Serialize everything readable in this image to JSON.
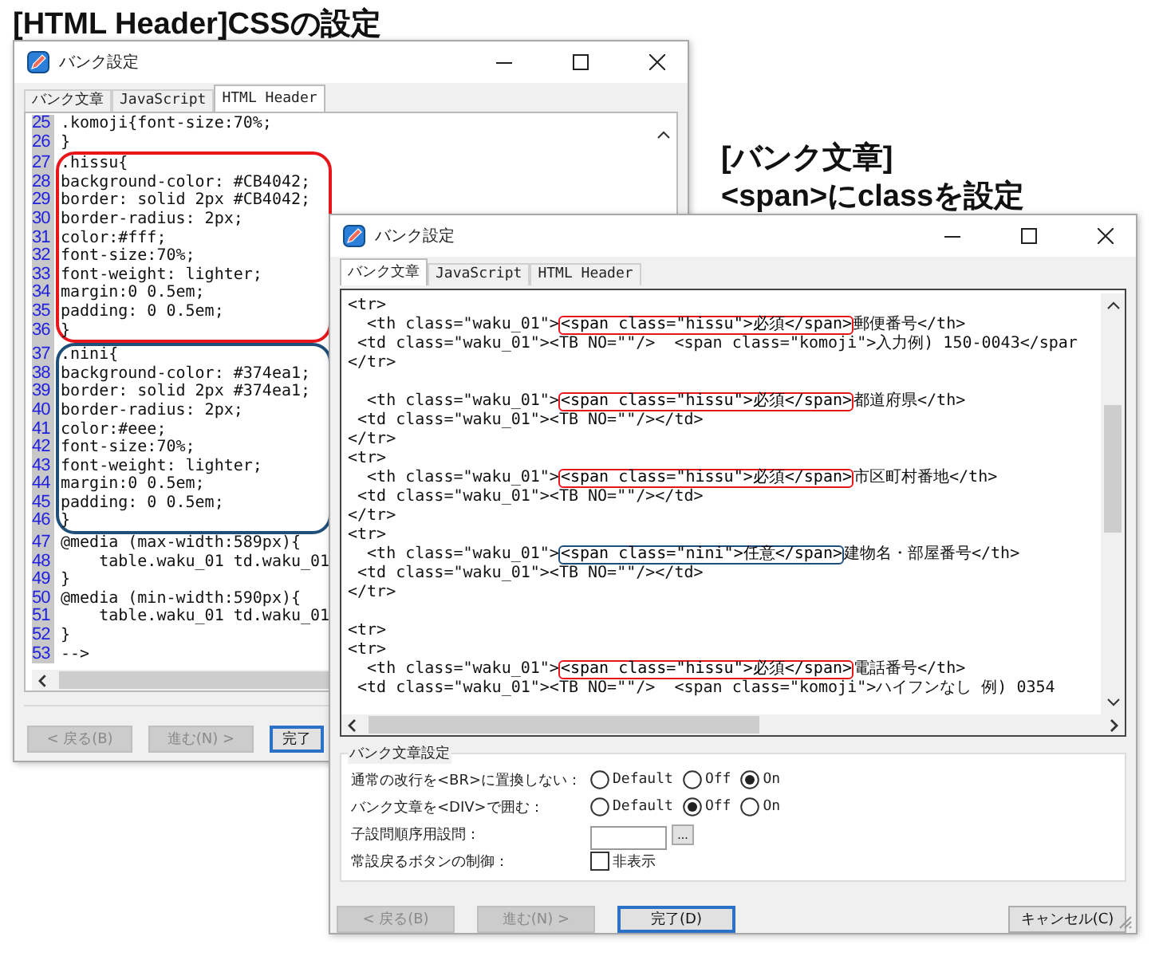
{
  "headings": [
    {
      "text": "[HTML Header]CSSの設定"
    },
    {
      "text": "[バンク文章]"
    },
    {
      "text": "<span>にclassを設定"
    }
  ],
  "back_window": {
    "title": "バンク設定",
    "tabs": [
      {
        "label": "バンク文章",
        "selected": false
      },
      {
        "label": "JavaScript",
        "selected": false
      },
      {
        "label": "HTML Header",
        "selected": true
      }
    ],
    "groups": [
      {
        "lines": [
          {
            "number": "25",
            "text": ".komoji{font-size:70%;"
          },
          {
            "number": "26",
            "text": "}"
          }
        ]
      },
      {
        "color": "#e8161b",
        "lines": [
          {
            "number": "27",
            "text": ".hissu{"
          },
          {
            "number": "28",
            "text": "background-color: #CB4042;"
          },
          {
            "number": "29",
            "text": "border: solid 2px #CB4042;"
          },
          {
            "number": "30",
            "text": "border-radius: 2px;"
          },
          {
            "number": "31",
            "text": "color:#fff;"
          },
          {
            "number": "32",
            "text": "font-size:70%;"
          },
          {
            "number": "33",
            "text": "font-weight: lighter;"
          },
          {
            "number": "34",
            "text": "margin:0 0.5em;"
          },
          {
            "number": "35",
            "text": "padding: 0 0.5em;"
          },
          {
            "number": "36",
            "text": "}"
          }
        ]
      },
      {
        "color": "#1f4e79",
        "lines": [
          {
            "number": "37",
            "text": ".nini{"
          },
          {
            "number": "38",
            "text": "background-color: #374ea1;"
          },
          {
            "number": "39",
            "text": "border: solid 2px #374ea1;"
          },
          {
            "number": "40",
            "text": "border-radius: 2px;"
          },
          {
            "number": "41",
            "text": "color:#eee;"
          },
          {
            "number": "42",
            "text": "font-size:70%;"
          },
          {
            "number": "43",
            "text": "font-weight: lighter;"
          },
          {
            "number": "44",
            "text": "margin:0 0.5em;"
          },
          {
            "number": "45",
            "text": "padding: 0 0.5em;"
          },
          {
            "number": "46",
            "text": "}"
          }
        ]
      },
      {
        "lines": [
          {
            "number": "47",
            "text": "@media (max-width:589px){"
          },
          {
            "number": "48",
            "text": "    table.waku_01 td.waku_01"
          },
          {
            "number": "49",
            "text": "}"
          },
          {
            "number": "50",
            "text": "@media (min-width:590px){"
          },
          {
            "number": "51",
            "text": "    table.waku_01 td.waku_01"
          },
          {
            "number": "52",
            "text": "}"
          },
          {
            "number": "53",
            "text": "-->"
          }
        ]
      }
    ],
    "buttons": [
      {
        "label": "< 戻る(B)",
        "disabled": true,
        "focused": false
      },
      {
        "label": "進む(N) >",
        "disabled": true,
        "focused": false
      },
      {
        "label": "完了",
        "disabled": false,
        "focused": true
      }
    ]
  },
  "front_window": {
    "title": "バンク設定",
    "tabs": [
      {
        "label": "バンク文章",
        "selected": true
      },
      {
        "label": "JavaScript",
        "selected": false
      },
      {
        "label": "HTML Header",
        "selected": false
      }
    ],
    "lines": [
      {
        "kind": "code",
        "text": "<tr>"
      },
      {
        "kind": "code",
        "before": "  <th class=\"waku_01\">",
        "span": "<span class=\"hissu\">必須</span>",
        "after": "郵便番号</th>",
        "color": "#e8161b"
      },
      {
        "kind": "code",
        "text": " <td class=\"waku_01\"><TB NO=\"\"/>  <span class=\"komoji\">入力例) 150-0043</spar"
      },
      {
        "kind": "code",
        "text": "</tr>"
      },
      {
        "kind": "blank"
      },
      {
        "kind": "code",
        "before": "  <th class=\"waku_01\">",
        "span": "<span class=\"hissu\">必須</span>",
        "after": "都道府県</th>",
        "color": "#e8161b"
      },
      {
        "kind": "code",
        "text": " <td class=\"waku_01\"><TB NO=\"\"/></td>"
      },
      {
        "kind": "code",
        "text": "</tr>"
      },
      {
        "kind": "code",
        "text": "<tr>"
      },
      {
        "kind": "code",
        "before": "  <th class=\"waku_01\">",
        "span": "<span class=\"hissu\">必須</span>",
        "after": "市区町村番地</th>",
        "color": "#e8161b"
      },
      {
        "kind": "code",
        "text": " <td class=\"waku_01\"><TB NO=\"\"/></td>"
      },
      {
        "kind": "code",
        "text": "</tr>"
      },
      {
        "kind": "code",
        "text": "<tr>"
      },
      {
        "kind": "code",
        "before": "  <th class=\"waku_01\">",
        "span": "<span class=\"nini\">任意</span>",
        "after": "建物名・部屋番号</th>",
        "color": "#1f4e79"
      },
      {
        "kind": "code",
        "text": " <td class=\"waku_01\"><TB NO=\"\"/></td>"
      },
      {
        "kind": "code",
        "text": "</tr>"
      },
      {
        "kind": "blank"
      },
      {
        "kind": "code",
        "text": "<tr>"
      },
      {
        "kind": "code",
        "text": "<tr>"
      },
      {
        "kind": "code",
        "before": "  <th class=\"waku_01\">",
        "span": "<span class=\"hissu\">必須</span>",
        "after": "電話番号</th>",
        "color": "#e8161b"
      },
      {
        "kind": "code",
        "text": " <td class=\"waku_01\"><TB NO=\"\"/>  <span class=\"komoji\">ハイフンなし 例) 0354"
      }
    ],
    "settings": {
      "title": "バンク文章設定",
      "rows": [
        {
          "kind": "radio",
          "label": "通常の改行を<BR>に置換しない：",
          "options": [
            {
              "label": "Default",
              "selected": false
            },
            {
              "label": "Off",
              "selected": false
            },
            {
              "label": "On",
              "selected": true
            }
          ]
        },
        {
          "kind": "radio",
          "label": "バンク文章を<DIV>で囲む：",
          "options": [
            {
              "label": "Default",
              "selected": false
            },
            {
              "label": "Off",
              "selected": true
            },
            {
              "label": "On",
              "selected": false
            }
          ]
        },
        {
          "kind": "input",
          "label": "子設問順序用設問：",
          "button": "..."
        },
        {
          "kind": "checkbox",
          "label": "常設戻るボタンの制御：",
          "option": "非表示",
          "checked": false
        }
      ]
    },
    "buttons": [
      {
        "label": "< 戻る(B)",
        "disabled": true,
        "focused": false
      },
      {
        "label": "進む(N) >",
        "disabled": true,
        "focused": false
      },
      {
        "label": "完了(D)",
        "disabled": false,
        "focused": true
      },
      {
        "label": "キャンセル(C)",
        "disabled": false,
        "focused": false
      }
    ]
  }
}
